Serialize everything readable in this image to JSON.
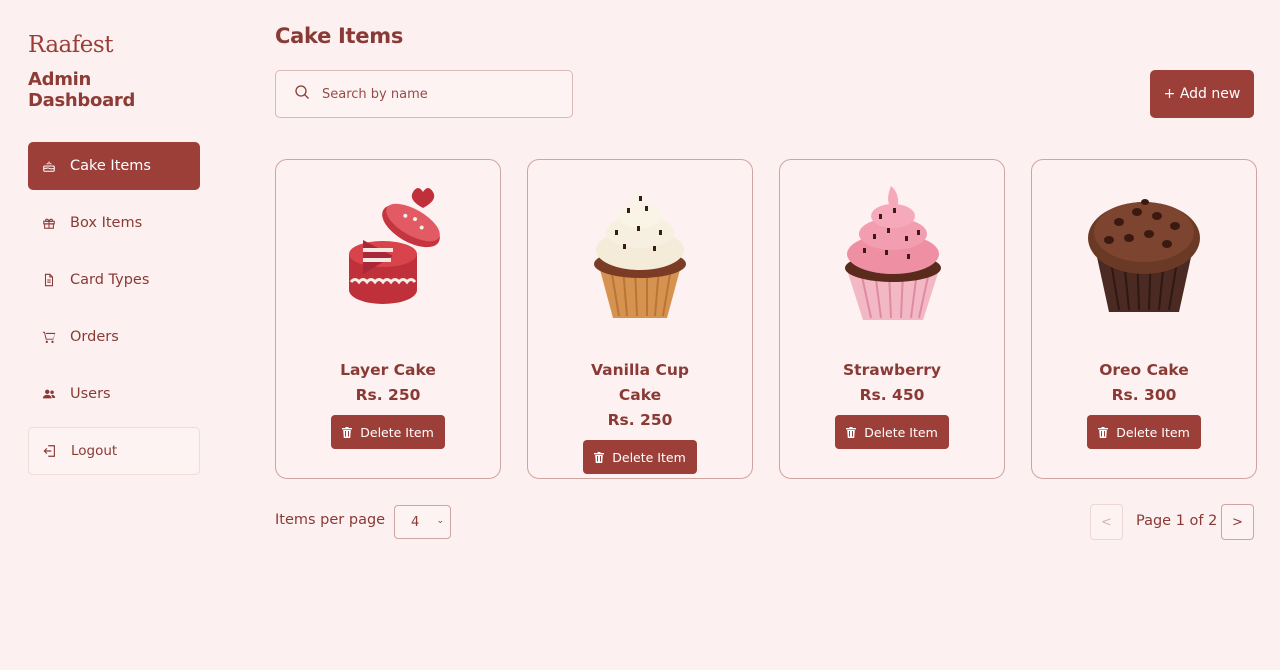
{
  "sidebar": {
    "logo": "Raafest",
    "subtitle": "Admin Dashboard",
    "items": [
      {
        "label": "Cake Items",
        "icon": "cake-icon",
        "active": true
      },
      {
        "label": "Box Items",
        "icon": "gift-icon",
        "active": false
      },
      {
        "label": "Card Types",
        "icon": "document-icon",
        "active": false
      },
      {
        "label": "Orders",
        "icon": "cart-icon",
        "active": false
      },
      {
        "label": "Users",
        "icon": "users-icon",
        "active": false
      }
    ],
    "logout_label": "Logout"
  },
  "main": {
    "title": "Cake Items",
    "search_placeholder": "Search by name",
    "add_label": "+ Add new",
    "delete_label": "Delete Item",
    "cards": [
      {
        "name": "Layer Cake",
        "price": "Rs. 250",
        "image": "red-layer-cake-box"
      },
      {
        "name": "Vanilla Cup Cake",
        "price": "Rs. 250",
        "image": "vanilla-cupcake"
      },
      {
        "name": "Strawberry",
        "price": "Rs. 450",
        "image": "strawberry-cupcake"
      },
      {
        "name": "Oreo Cake",
        "price": "Rs. 300",
        "image": "chocolate-muffin"
      }
    ]
  },
  "pagination": {
    "items_per_page_label": "Items per page",
    "items_per_page": "4",
    "page_text": "Page 1 of 2",
    "prev_label": "<",
    "next_label": ">"
  },
  "colors": {
    "background": "#fcf0f0",
    "accent": "#9c3f39",
    "text": "#8a3a35"
  }
}
